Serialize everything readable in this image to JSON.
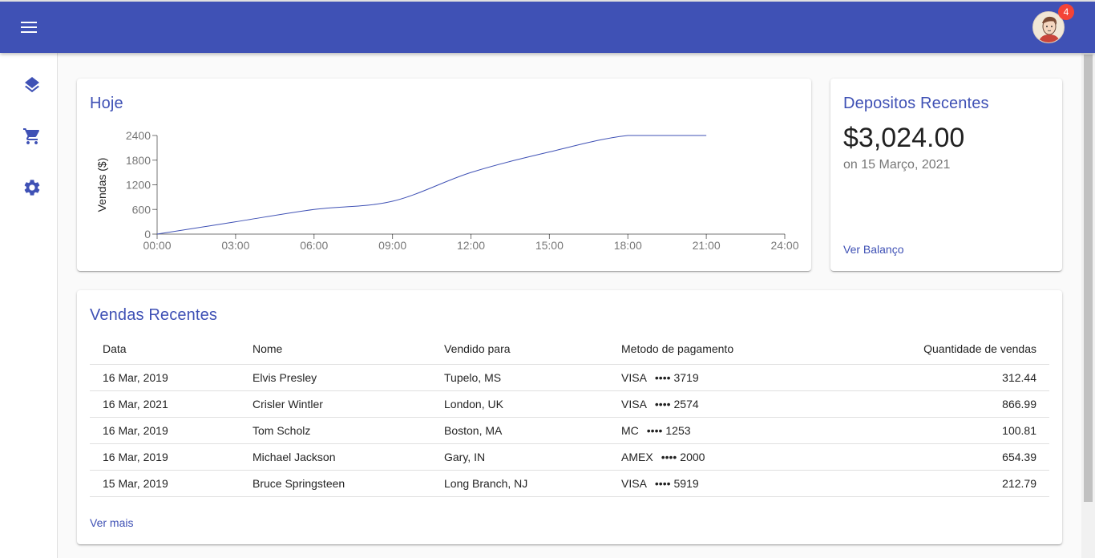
{
  "appbar": {
    "menu_icon": "menu-icon",
    "notification_count": "4",
    "colors": {
      "primary": "#3f51b5",
      "badge": "#f44336"
    }
  },
  "sidebar": {
    "items": [
      {
        "icon": "layers-icon"
      },
      {
        "icon": "shopping-cart-icon"
      },
      {
        "icon": "gear-icon"
      }
    ]
  },
  "today": {
    "title": "Hoje"
  },
  "chart_data": {
    "type": "line",
    "title": "Hoje",
    "xlabel": "",
    "ylabel": "Vendas ($)",
    "x_ticks": [
      "00:00",
      "03:00",
      "06:00",
      "09:00",
      "12:00",
      "15:00",
      "18:00",
      "21:00",
      "24:00"
    ],
    "y_ticks": [
      "0",
      "600",
      "1200",
      "1800",
      "2400"
    ],
    "xlim": [
      0,
      24
    ],
    "ylim": [
      0,
      2400
    ],
    "series": [
      {
        "x": [
          0,
          3,
          6,
          9,
          12,
          15,
          18,
          21
        ],
        "y": [
          0,
          300,
          600,
          800,
          1500,
          2000,
          2400,
          2400
        ]
      }
    ],
    "grid": false,
    "color": "#3f51b5"
  },
  "deposits": {
    "title": "Depositos Recentes",
    "amount": "$3,024.00",
    "date": "on 15 Março, 2021",
    "link": "Ver Balanço"
  },
  "sales": {
    "title": "Vendas Recentes",
    "headers": [
      "Data",
      "Nome",
      "Vendido para",
      "Metodo de pagamento",
      "Quantidade de vendas"
    ],
    "rows": [
      {
        "date": "16 Mar, 2019",
        "name": "Elvis Presley",
        "ship_to": "Tupelo, MS",
        "method": "VISA",
        "card": "3719",
        "amount": "312.44"
      },
      {
        "date": "16 Mar, 2021",
        "name": "Crisler Wintler",
        "ship_to": "London, UK",
        "method": "VISA",
        "card": "2574",
        "amount": "866.99"
      },
      {
        "date": "16 Mar, 2019",
        "name": "Tom Scholz",
        "ship_to": "Boston, MA",
        "method": "MC",
        "card": "1253",
        "amount": "100.81"
      },
      {
        "date": "16 Mar, 2019",
        "name": "Michael Jackson",
        "ship_to": "Gary, IN",
        "method": "AMEX",
        "card": "2000",
        "amount": "654.39"
      },
      {
        "date": "15 Mar, 2019",
        "name": "Bruce Springsteen",
        "ship_to": "Long Branch, NJ",
        "method": "VISA",
        "card": "5919",
        "amount": "212.79"
      }
    ],
    "card_mask": "••••",
    "link": "Ver mais"
  }
}
